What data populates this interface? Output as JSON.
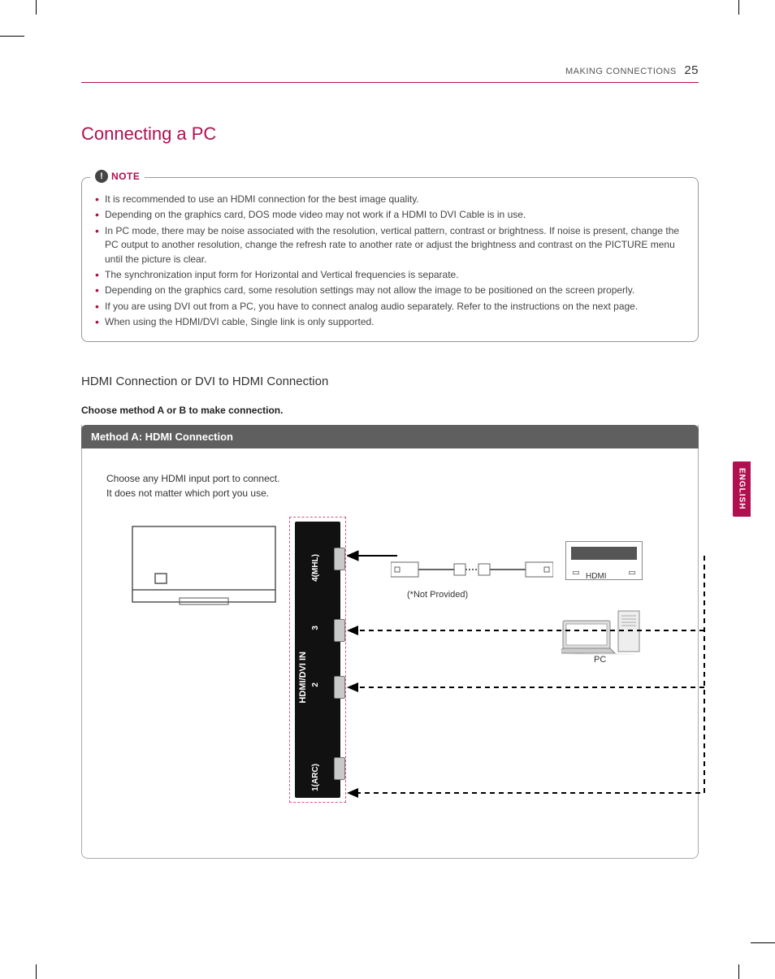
{
  "header": {
    "section": "MAKING CONNECTIONS",
    "page": "25"
  },
  "title": "Connecting a PC",
  "note": {
    "label": "NOTE",
    "items": [
      "It is recommended to use an HDMI connection for the best image quality.",
      "Depending on the graphics card, DOS mode video may not work if a HDMI to DVI Cable is in use.",
      "In PC mode, there may be noise associated with the resolution, vertical pattern, contrast or brightness. If noise is present, change the PC output to another resolution, change the refresh rate to another rate or adjust the brightness and contrast on the PICTURE menu until the picture is clear.",
      "The synchronization input form for Horizontal and Vertical frequencies is separate.",
      "Depending on the graphics card, some resolution settings may not allow the image to be positioned on the screen properly.",
      "If you are using DVI out from a PC, you have to connect analog audio separately. Refer to the instructions on the next page.",
      "When using the HDMI/DVI cable, Single link is only supported."
    ]
  },
  "subsection": "HDMI Connection or DVI to HDMI Connection",
  "instruction": "Choose method A or B to make connection.",
  "method": {
    "header": "Method A: HDMI Connection",
    "body_line1": "Choose any HDMI input port to connect.",
    "body_line2": "It does not matter which port you use."
  },
  "diagram": {
    "port_main_label": "HDMI/DVI IN",
    "port4": "4(MHL)",
    "port3": "3",
    "port2": "2",
    "port1": "1(ARC)",
    "not_provided": "(*Not Provided)",
    "hdmi": "HDMI",
    "pc": "PC"
  },
  "side_tab": "ENGLISH"
}
